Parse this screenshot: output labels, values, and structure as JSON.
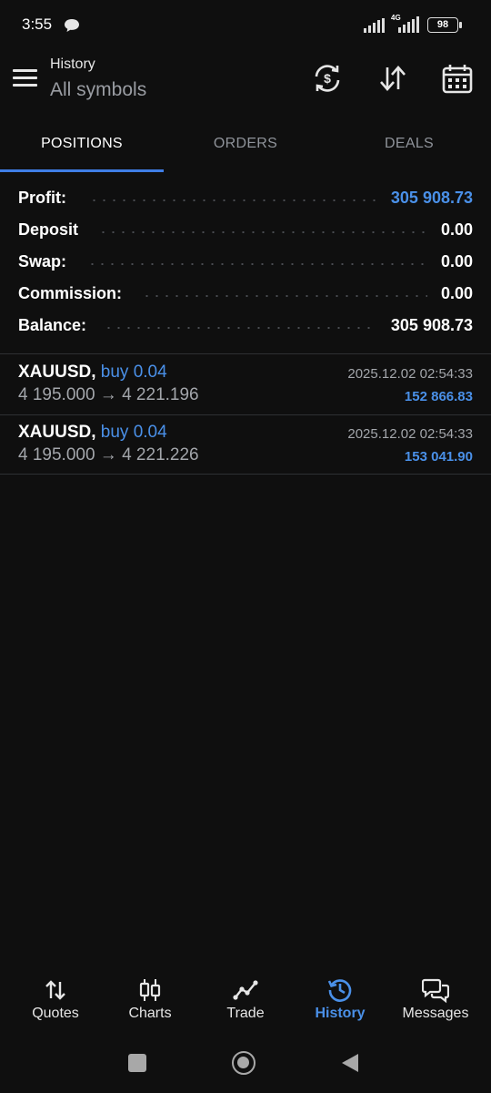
{
  "status_bar": {
    "time": "3:55",
    "network": "4G",
    "battery": "98"
  },
  "header": {
    "title": "History",
    "subtitle": "All symbols",
    "icons": [
      "currency-exchange-icon",
      "sort-icon",
      "calendar-icon"
    ]
  },
  "tabs": [
    {
      "label": "POSITIONS",
      "active": true
    },
    {
      "label": "ORDERS",
      "active": false
    },
    {
      "label": "DEALS",
      "active": false
    }
  ],
  "summary": [
    {
      "label": "Profit:",
      "value": "305 908.73",
      "highlight": true
    },
    {
      "label": "Deposit",
      "value": "0.00"
    },
    {
      "label": "Swap:",
      "value": "0.00"
    },
    {
      "label": "Commission:",
      "value": "0.00"
    },
    {
      "label": "Balance:",
      "value": "305 908.73"
    }
  ],
  "positions": [
    {
      "symbol": "XAUUSD,",
      "side": "buy 0.04",
      "price": "4 195.000 → 4 221.196",
      "time": "2025.12.02 02:54:33",
      "profit": "152 866.83"
    },
    {
      "symbol": "XAUUSD,",
      "side": "buy 0.04",
      "price": "4 195.000 → 4 221.226",
      "time": "2025.12.02 02:54:33",
      "profit": "153 041.90"
    }
  ],
  "bottom_nav": [
    {
      "label": "Quotes",
      "icon": "quotes-icon"
    },
    {
      "label": "Charts",
      "icon": "candles-icon"
    },
    {
      "label": "Trade",
      "icon": "trade-line-icon"
    },
    {
      "label": "History",
      "icon": "history-icon",
      "active": true
    },
    {
      "label": "Messages",
      "icon": "messages-icon"
    }
  ],
  "colors": {
    "background": "#0f0f0f",
    "accent": "#4a90e8",
    "muted_text": "#a3a6ab"
  }
}
